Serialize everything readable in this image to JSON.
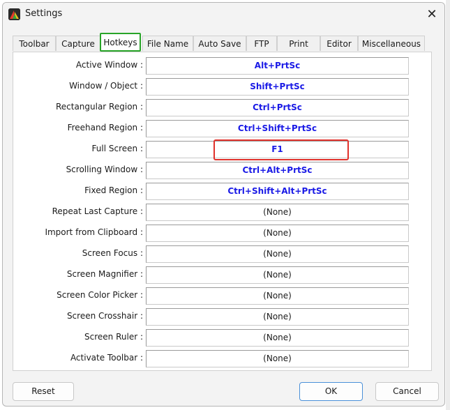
{
  "window": {
    "title": "Settings",
    "close_glyph": "✕",
    "icon": "app-icon"
  },
  "tabs": [
    {
      "label": "Toolbar",
      "active": false
    },
    {
      "label": "Capture",
      "active": false
    },
    {
      "label": "Hotkeys",
      "active": true
    },
    {
      "label": "File Name",
      "active": false
    },
    {
      "label": "Auto Save",
      "active": false
    },
    {
      "label": "FTP",
      "active": false
    },
    {
      "label": "Print",
      "active": false
    },
    {
      "label": "Editor",
      "active": false
    },
    {
      "label": "Miscellaneous",
      "active": false
    }
  ],
  "hotkeys": [
    {
      "label": "Active Window :",
      "value": "Alt+PrtSc"
    },
    {
      "label": "Window / Object :",
      "value": "Shift+PrtSc"
    },
    {
      "label": "Rectangular Region :",
      "value": "Ctrl+PrtSc"
    },
    {
      "label": "Freehand Region :",
      "value": "Ctrl+Shift+PrtSc"
    },
    {
      "label": "Full Screen :",
      "value": "F1"
    },
    {
      "label": "Scrolling Window :",
      "value": "Ctrl+Alt+PrtSc"
    },
    {
      "label": "Fixed Region :",
      "value": "Ctrl+Shift+Alt+PrtSc"
    },
    {
      "label": "Repeat Last Capture :",
      "value": "(None)"
    },
    {
      "label": "Import from Clipboard :",
      "value": "(None)"
    },
    {
      "label": "Screen Focus :",
      "value": "(None)"
    },
    {
      "label": "Screen Magnifier :",
      "value": "(None)"
    },
    {
      "label": "Screen Color Picker :",
      "value": "(None)"
    },
    {
      "label": "Screen Crosshair :",
      "value": "(None)"
    },
    {
      "label": "Screen Ruler :",
      "value": "(None)"
    },
    {
      "label": "Activate Toolbar :",
      "value": "(None)"
    }
  ],
  "buttons": {
    "reset": "Reset",
    "ok": "OK",
    "cancel": "Cancel"
  },
  "colors": {
    "active_tab_outline": "#28a428",
    "highlight_outline": "#e0312b",
    "hotkey_text": "#1a1ae6",
    "ok_border": "#4a90d9"
  }
}
